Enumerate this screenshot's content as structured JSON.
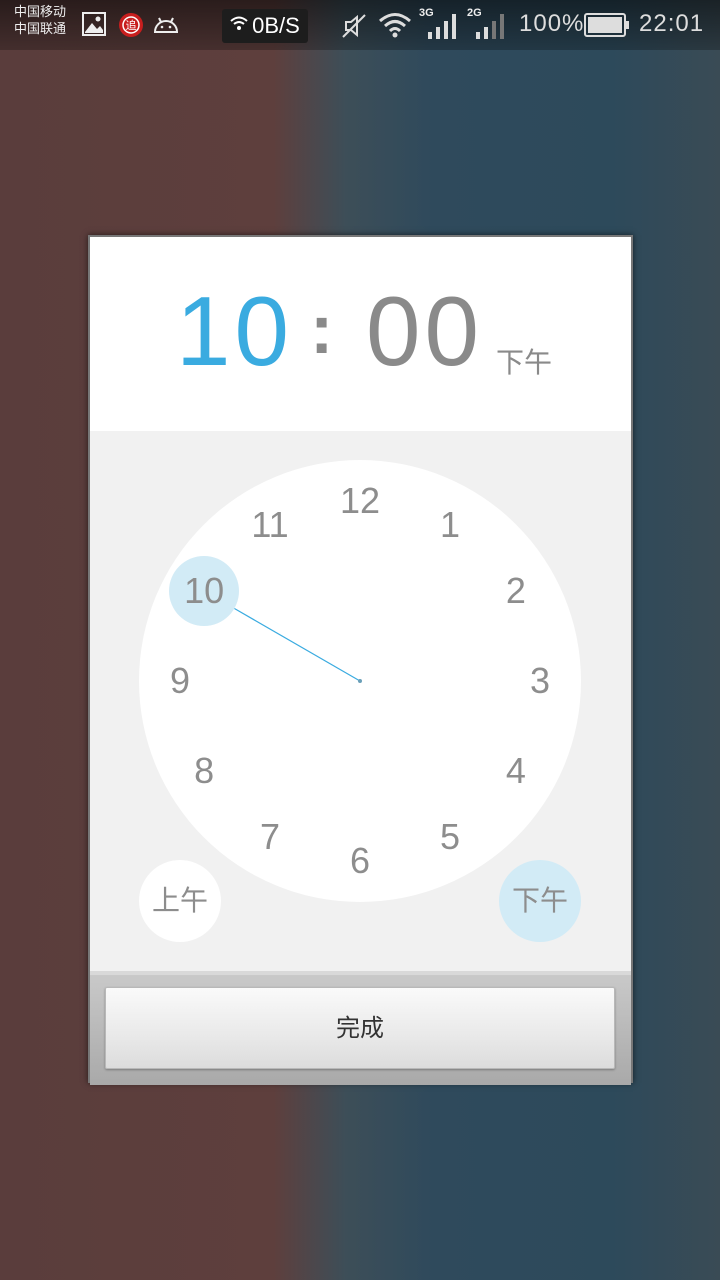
{
  "status_bar": {
    "carrier_1": "中国移动",
    "carrier_2": "中国联通",
    "net_speed": "0B/S",
    "sim1_network": "3G",
    "sim2_network": "2G",
    "battery_percent": "100%",
    "time": "22:01",
    "icons": [
      "image-icon",
      "notification-app-icon",
      "android-icon",
      "wifi-small-icon",
      "mute-icon",
      "wifi-icon",
      "signal-icon",
      "signal-icon",
      "battery-icon"
    ]
  },
  "time_picker": {
    "hour": "10",
    "separator": ":",
    "minute": "00",
    "period": "下午",
    "selected_hour": 10,
    "dial_numbers": [
      "12",
      "1",
      "2",
      "3",
      "4",
      "5",
      "6",
      "7",
      "8",
      "9",
      "10",
      "11"
    ],
    "am_label": "上午",
    "pm_label": "下午",
    "selected_period": "pm",
    "accent_color": "#3aabe0",
    "selection_color": "#d2ebf6"
  },
  "footer": {
    "done_label": "完成"
  }
}
